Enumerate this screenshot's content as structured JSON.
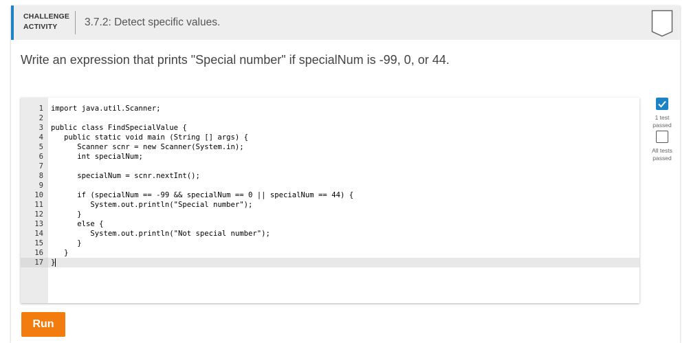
{
  "header": {
    "activity_type_line1": "CHALLENGE",
    "activity_type_line2": "ACTIVITY",
    "title": "3.7.2: Detect specific values.",
    "accent_color": "#1d83c7"
  },
  "prompt": "Write an expression that prints \"Special number\" if specialNum is -99, 0, or 44.",
  "editor": {
    "language": "java",
    "active_line": 17,
    "lines": [
      "import java.util.Scanner;",
      "",
      "public class FindSpecialValue {",
      "   public static void main (String [] args) {",
      "      Scanner scnr = new Scanner(System.in);",
      "      int specialNum;",
      "",
      "      specialNum = scnr.nextInt();",
      "",
      "      if (specialNum == -99 && specialNum == 0 || specialNum == 44) {",
      "         System.out.println(\"Special number\");",
      "      }",
      "      else {",
      "         System.out.println(\"Not special number\");",
      "      }",
      "   }",
      "}"
    ]
  },
  "tests": {
    "test1_label": "1 test passed",
    "test1_passed": true,
    "all_label": "All tests passed",
    "all_passed": false,
    "pass_color": "#1d83c7"
  },
  "run_button": {
    "label": "Run",
    "color": "#f27c0e"
  }
}
